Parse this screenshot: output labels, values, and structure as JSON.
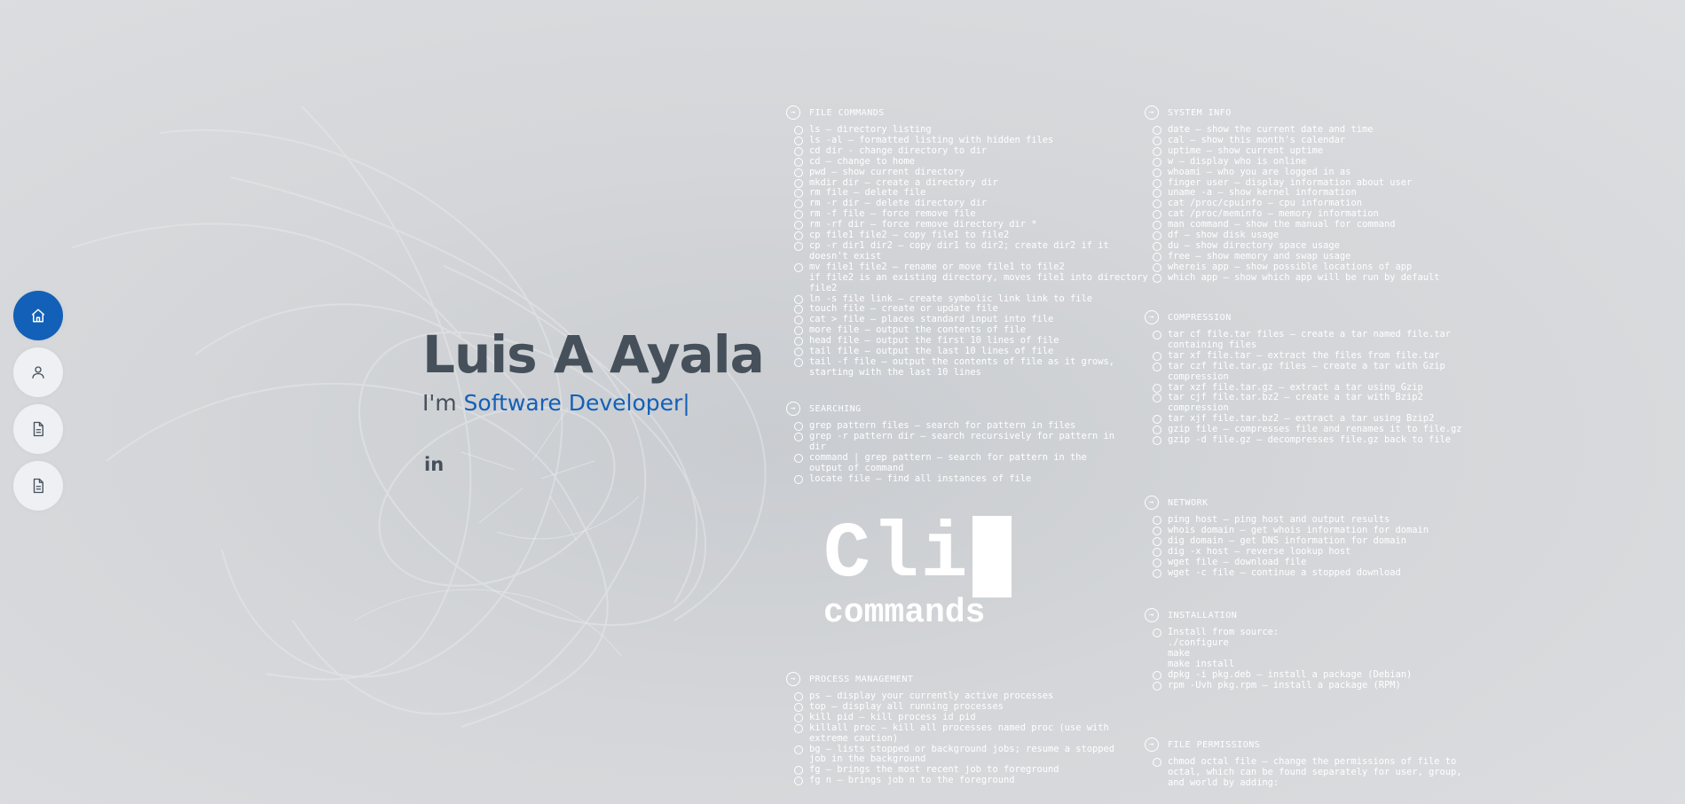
{
  "nav": [
    {
      "icon": "home-icon",
      "active": true
    },
    {
      "icon": "user-icon",
      "active": false
    },
    {
      "icon": "file-icon",
      "active": false
    },
    {
      "icon": "file-icon",
      "active": false
    }
  ],
  "hero": {
    "name": "Luis A Ayala",
    "prefix": "I'm ",
    "role": "Software Developer",
    "cursor": "|",
    "social": "in"
  },
  "logo": {
    "big": "Cli",
    "small": "commands"
  },
  "sections": [
    {
      "title": "FILE COMMANDS",
      "items": [
        "ls – directory listing",
        "ls -al – formatted listing with hidden files",
        "cd dir - change directory to dir",
        "cd – change to home",
        "pwd – show current directory",
        "mkdir dir – create a directory dir",
        "rm file – delete file",
        "rm -r dir – delete directory dir",
        "rm -f file – force remove file",
        "rm -rf dir – force remove directory dir *",
        "cp file1 file2 – copy file1 to file2",
        "cp -r dir1 dir2 – copy dir1 to dir2; create dir2 if it doesn't exist",
        "mv file1 file2 – rename or move file1 to file2\nif file2 is an existing directory, moves file1 into directory file2",
        "ln -s file link – create symbolic link link to file",
        "touch file – create or update file",
        "cat > file – places standard input into file",
        "more file – output the contents of file",
        "head file – output the first 10 lines of file",
        "tail file – output the last 10 lines of file",
        "tail -f file – output the contents of file as it grows, starting with the last 10 lines"
      ]
    },
    {
      "title": "SEARCHING",
      "items": [
        "grep pattern files – search for pattern in files",
        "grep -r pattern dir – search recursively for pattern in dir",
        "command | grep pattern – search for pattern in the output of command",
        "locate file – find all instances of file"
      ]
    },
    {
      "title": "PROCESS MANAGEMENT",
      "items": [
        "ps – display your currently active processes",
        "top – display all running processes",
        "kill pid – kill process id pid",
        "killall proc – kill all processes named proc (use with extreme caution)",
        "bg – lists stopped or background jobs; resume a stopped job in the background",
        "fg – brings the most recent job to foreground",
        "fg n – brings job n to the foreground"
      ]
    },
    {
      "title": "SYSTEM INFO",
      "items": [
        "date – show the current date and time",
        "cal – show this month's calendar",
        "uptime – show current uptime",
        "w – display who is online",
        "whoami – who you are logged in as",
        "finger user – display information about user",
        "uname -a – show kernel information",
        "cat /proc/cpuinfo – cpu information",
        "cat /proc/meminfo – memory information",
        "man command – show the manual for command",
        "df – show disk usage",
        "du – show directory space usage",
        "free – show memory and swap usage",
        "whereis app – show possible locations of app",
        "which app – show which app will be run by default"
      ]
    },
    {
      "title": "COMPRESSION",
      "items": [
        "tar cf file.tar files – create a tar named file.tar containing files",
        "tar xf file.tar – extract the files from file.tar",
        "tar czf file.tar.gz files – create a tar with Gzip compression",
        "tar xzf file.tar.gz – extract a tar using Gzip",
        "tar cjf file.tar.bz2 – create a tar with Bzip2 compression",
        "tar xjf file.tar.bz2 – extract a tar using Bzip2",
        "gzip file – compresses file and renames it to file.gz",
        "gzip -d file.gz – decompresses file.gz back to file"
      ]
    },
    {
      "title": "NETWORK",
      "items": [
        "ping host – ping host and output results",
        "whois domain – get whois information for domain",
        "dig domain – get DNS information for domain",
        "dig -x host – reverse lookup host",
        "wget file – download file",
        "wget -c file – continue a stopped download"
      ]
    },
    {
      "title": "INSTALLATION",
      "items": [
        "Install from source:\n./configure\nmake\nmake install",
        "dpkg -i pkg.deb – install a package (Debian)",
        "rpm -Uvh pkg.rpm – install a package (RPM)"
      ]
    },
    {
      "title": "FILE PERMISSIONS",
      "items": [
        "chmod octal file – change the permissions of file to octal, which can be found separately for user, group, and world by adding:"
      ]
    }
  ]
}
